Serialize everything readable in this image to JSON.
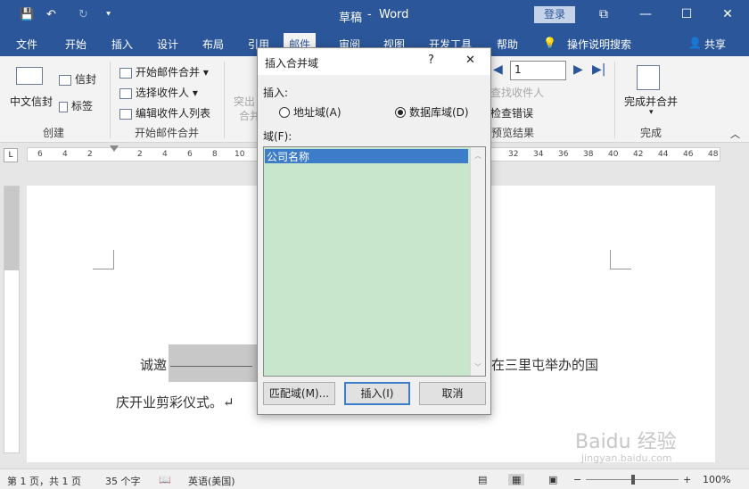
{
  "titlebar": {
    "doc_title": "草稿",
    "separator": "-",
    "app_name": "Word",
    "signin": "登录",
    "restore_glyph": "⧉",
    "minimize_glyph": "—",
    "maximize_glyph": "☐",
    "close_glyph": "✕",
    "save_glyph": "💾",
    "undo_glyph": "↶",
    "redo_glyph": "↻",
    "qat_more_glyph": "⯆"
  },
  "tabs": [
    "文件",
    "开始",
    "插入",
    "设计",
    "布局",
    "引用",
    "邮件",
    "审阅",
    "视图",
    "开发工具",
    "帮助"
  ],
  "tell_me": "操作说明搜索",
  "share": "共享",
  "ribbon": {
    "envelope_cn": "中文信封",
    "envelopes": "信封",
    "labels": "标签",
    "group_create": "创建",
    "start_merge": "开始邮件合并",
    "select_recipients": "选择收件人",
    "edit_recipients": "编辑收件人列表",
    "group_start": "开始邮件合并",
    "highlight_1": "突出",
    "highlight_2": "合并",
    "record_value": "1",
    "find_recipient": "查找收件人",
    "check_errors": "检查错误",
    "group_preview": "预览结果",
    "finish_merge": "完成并合并",
    "group_finish": "完成"
  },
  "ruler_numbers": [
    "6",
    "4",
    "2",
    "2",
    "4",
    "6",
    "8",
    "10",
    "32",
    "34",
    "36",
    "38",
    "40",
    "42",
    "44",
    "46",
    "48"
  ],
  "document": {
    "line1_prefix": "诚邀",
    "line1_suffix": "在三里屯举办的国",
    "line2": "庆开业剪彩仪式。↵"
  },
  "dialog": {
    "title": "插入合并域",
    "help": "?",
    "close": "✕",
    "insert_label": "插入:",
    "address_field": "地址域(A)",
    "database_field": "数据库域(D)",
    "fields_label": "域(F):",
    "fields": [
      "公司名称"
    ],
    "match_fields": "匹配域(M)...",
    "insert_button": "插入(I)",
    "cancel_button": "取消"
  },
  "status": {
    "page": "第 1 页，共 1 页",
    "words": "35 个字",
    "language": "英语(美国)",
    "zoom": "100%"
  },
  "watermark": "Baidu 经验",
  "watermark_url": "jingyan.baidu.com"
}
